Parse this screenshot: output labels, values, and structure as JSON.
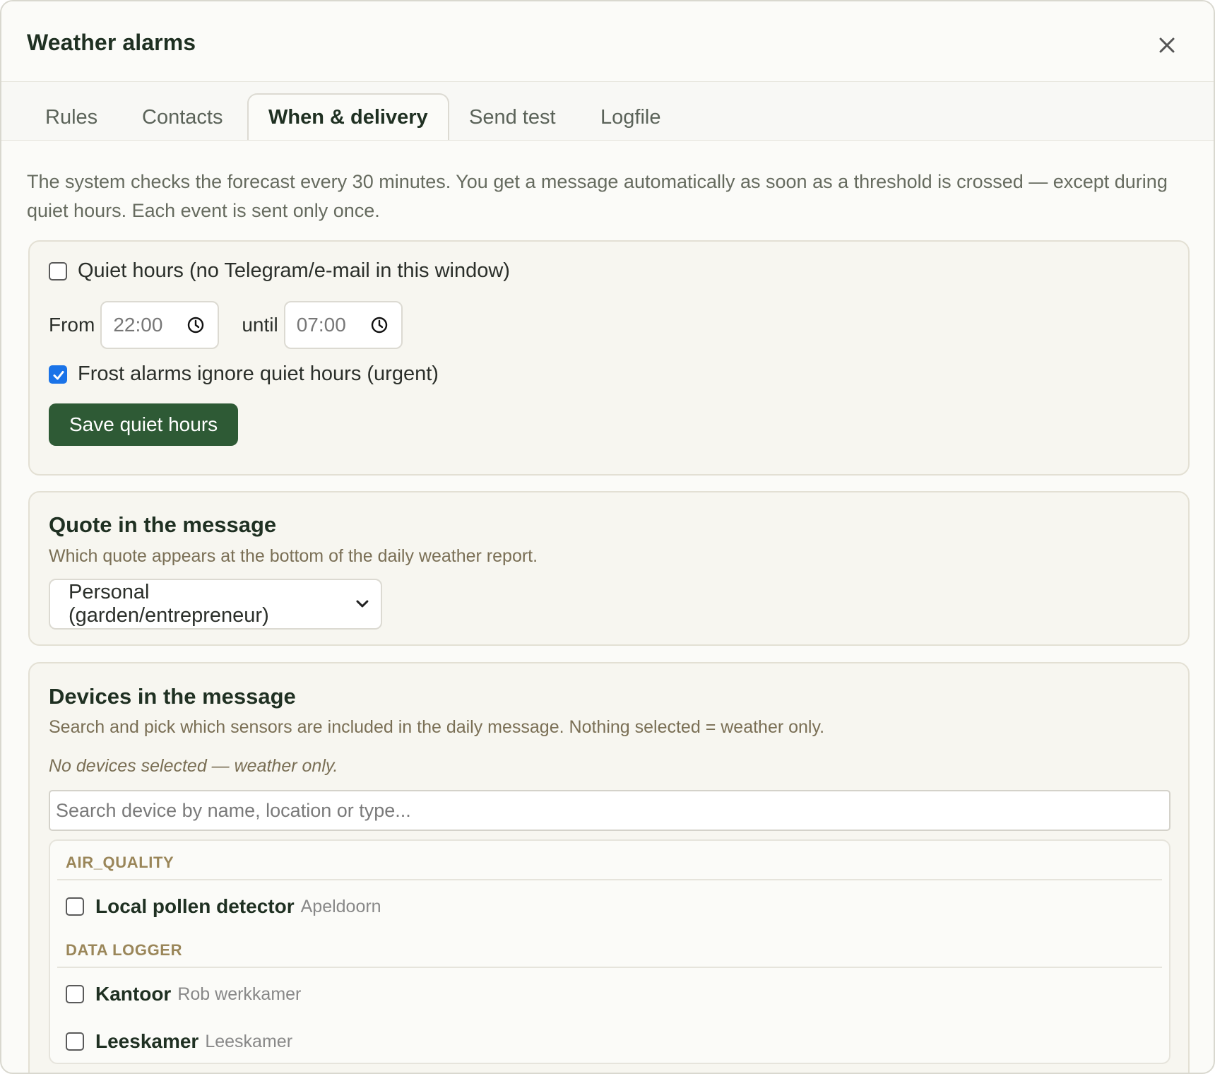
{
  "dialog": {
    "title": "Weather alarms",
    "close_icon": "close-icon"
  },
  "tabs": [
    {
      "label": "Rules",
      "active": false
    },
    {
      "label": "Contacts",
      "active": false
    },
    {
      "label": "When & delivery",
      "active": true
    },
    {
      "label": "Send test",
      "active": false
    },
    {
      "label": "Logfile",
      "active": false
    }
  ],
  "intro": "The system checks the forecast every 30 minutes. You get a message automatically as soon as a threshold is crossed — except during quiet hours. Each event is sent only once.",
  "quiet_hours": {
    "enabled_label": "Quiet hours (no Telegram/e-mail in this window)",
    "enabled": false,
    "from_label": "From",
    "from_value": "22:00",
    "until_label": "until",
    "until_value": "07:00",
    "time_icon": "clock-icon",
    "frost_label": "Frost alarms ignore quiet hours (urgent)",
    "frost_checked": true,
    "save_label": "Save quiet hours",
    "accent_color": "#2e5a35",
    "checkbox_color": "#1a73e8"
  },
  "quote": {
    "title": "Quote in the message",
    "description": "Which quote appears at the bottom of the daily weather report.",
    "selected": "Personal (garden/entrepreneur)",
    "dropdown_icon": "chevron-down-icon"
  },
  "devices": {
    "title": "Devices in the message",
    "description": "Search and pick which sensors are included in the daily message. Nothing selected = weather only.",
    "empty_note": "No devices selected — weather only.",
    "search_placeholder": "Search device by name, location or type...",
    "groups": [
      {
        "name": "AIR_QUALITY",
        "items": [
          {
            "name": "Local pollen detector",
            "location": "Apeldoorn",
            "checked": false
          }
        ]
      },
      {
        "name": "DATA LOGGER",
        "items": [
          {
            "name": "Kantoor",
            "location": "Rob werkkamer",
            "checked": false
          },
          {
            "name": "Leeskamer",
            "location": "Leeskamer",
            "checked": false
          }
        ]
      }
    ]
  }
}
